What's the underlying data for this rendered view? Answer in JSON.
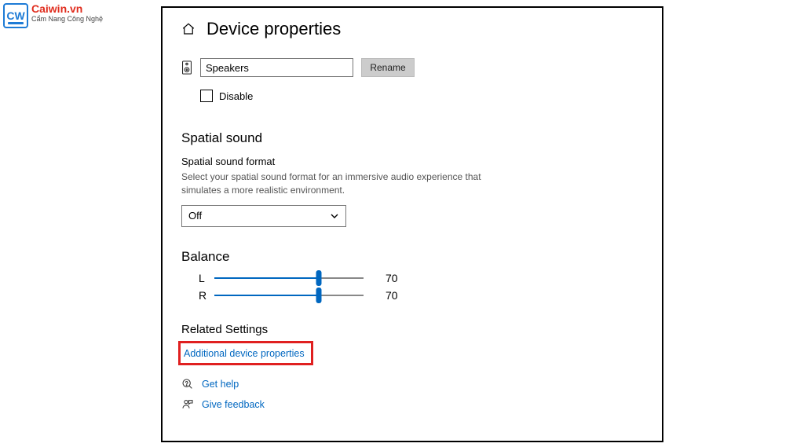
{
  "logo": {
    "badge": "CW",
    "title": "Caiwin.vn",
    "subtitle": "Cẩm Nang Công Nghệ"
  },
  "header": {
    "title": "Device properties"
  },
  "device": {
    "name_value": "Speakers",
    "rename_label": "Rename",
    "disable_label": "Disable"
  },
  "spatial": {
    "heading": "Spatial sound",
    "format_label": "Spatial sound format",
    "description": "Select your spatial sound format for an immersive audio experience that simulates a more realistic environment.",
    "selected": "Off"
  },
  "balance": {
    "heading": "Balance",
    "left_label": "L",
    "left_value": "70",
    "right_label": "R",
    "right_value": "70"
  },
  "related": {
    "heading": "Related Settings",
    "additional_link": "Additional device properties"
  },
  "footer": {
    "get_help": "Get help",
    "give_feedback": "Give feedback"
  }
}
